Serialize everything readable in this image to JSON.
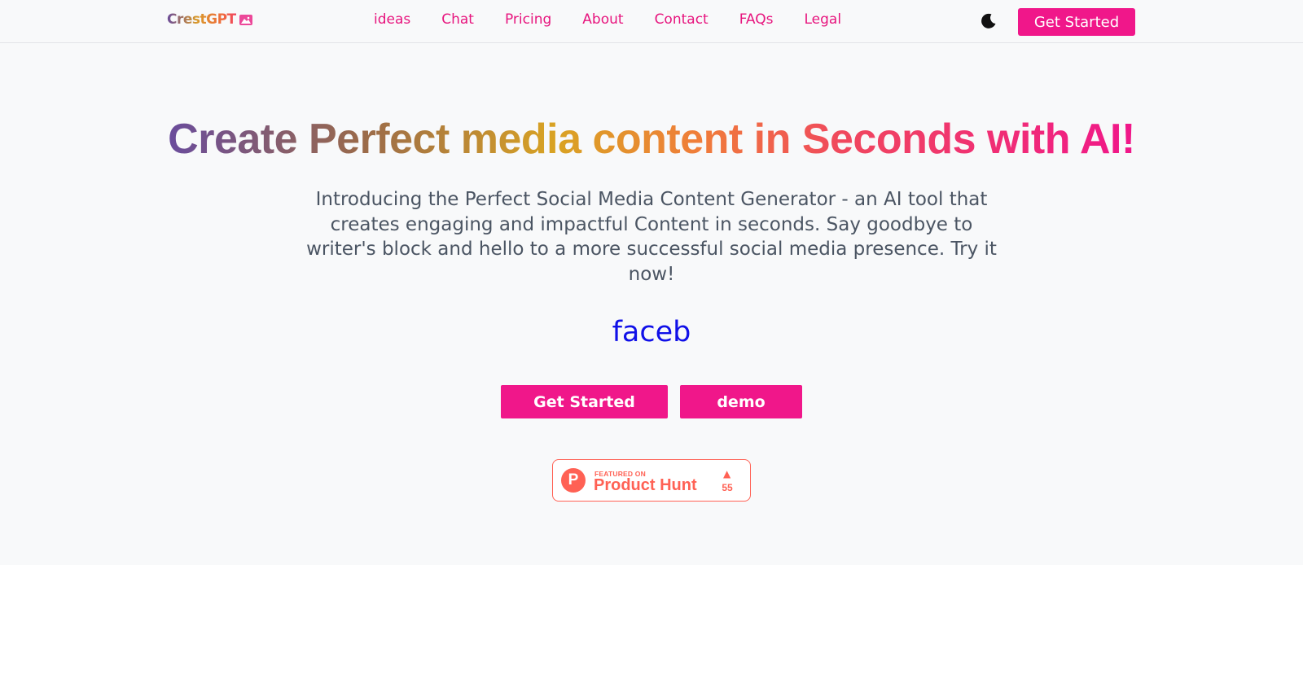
{
  "header": {
    "logo": "CrestGPT",
    "logo_icon": "image-icon",
    "nav": [
      "ideas",
      "Chat",
      "Pricing",
      "About",
      "Contact",
      "FAQs",
      "Legal"
    ],
    "theme_toggle_icon": "moon-icon",
    "cta_label": "Get Started"
  },
  "hero": {
    "headline": "Create Perfect media content in Seconds with AI!",
    "lead": "Introducing the Perfect Social Media Content Generator - an AI tool that creates engaging and impactful Content in seconds. Say goodbye to writer's block and hello to a more successful social media presence. Try it now!",
    "typed_text": "faceb",
    "primary_button": "Get Started",
    "secondary_button": "demo"
  },
  "product_hunt": {
    "logo_letter": "P",
    "featured_label": "FEATURED ON",
    "name": "Product Hunt",
    "upvote_icon": "triangle-up-icon",
    "upvotes": "55"
  },
  "colors": {
    "accent": "#f0178a",
    "typed_text": "#1010e8",
    "product_hunt": "#ff6154"
  }
}
